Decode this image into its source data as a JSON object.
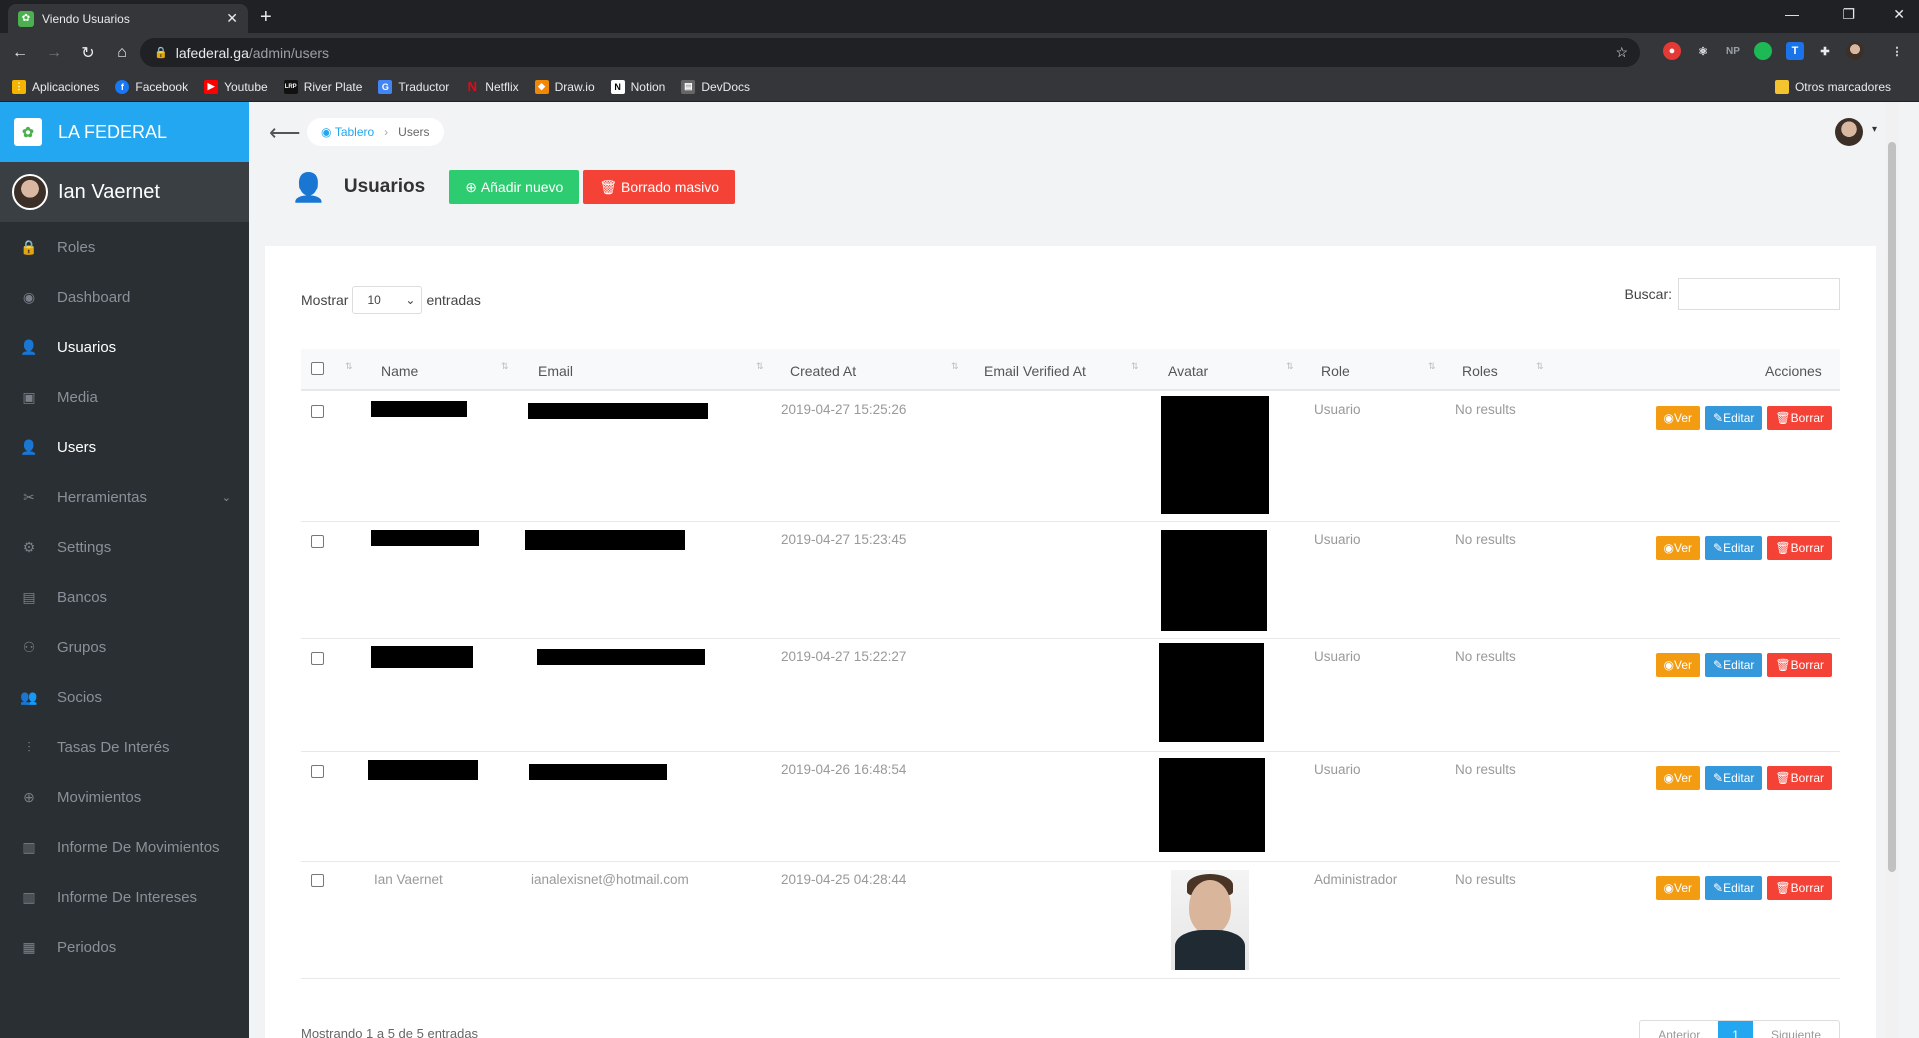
{
  "browser": {
    "tab_title": "Viendo Usuarios",
    "url_host": "lafederal.ga",
    "url_path": "/admin/users",
    "bookmarks": [
      {
        "label": "Aplicaciones",
        "color": "#f44336"
      },
      {
        "label": "Facebook",
        "color": "#1877f2"
      },
      {
        "label": "Youtube",
        "color": "#ff0000"
      },
      {
        "label": "River Plate",
        "color": "#111111"
      },
      {
        "label": "Traductor",
        "color": "#4285f4"
      },
      {
        "label": "Netflix",
        "color": "#e50914"
      },
      {
        "label": "Draw.io",
        "color": "#f08705"
      },
      {
        "label": "Notion",
        "color": "#ffffff"
      },
      {
        "label": "DevDocs",
        "color": "#555555"
      }
    ],
    "other_bookmarks": "Otros marcadores"
  },
  "sidebar": {
    "brand": "LA FEDERAL",
    "user_name": "Ian Vaernet",
    "items": [
      {
        "label": "Roles",
        "icon": "lock-icon",
        "glyph": "🔒"
      },
      {
        "label": "Dashboard",
        "icon": "dashboard-icon",
        "glyph": "◉"
      },
      {
        "label": "Usuarios",
        "icon": "person-icon",
        "glyph": "👤",
        "active": true
      },
      {
        "label": "Media",
        "icon": "image-icon",
        "glyph": "▣"
      },
      {
        "label": "Users",
        "icon": "person-icon",
        "glyph": "👤",
        "active": true
      },
      {
        "label": "Herramientas",
        "icon": "tools-icon",
        "glyph": "✂",
        "caret": true
      },
      {
        "label": "Settings",
        "icon": "gear-icon",
        "glyph": "⚙"
      },
      {
        "label": "Bancos",
        "icon": "bank-icon",
        "glyph": "▤"
      },
      {
        "label": "Grupos",
        "icon": "group-icon",
        "glyph": "⚇"
      },
      {
        "label": "Socios",
        "icon": "people-icon",
        "glyph": "👥"
      },
      {
        "label": "Tasas De Interés",
        "icon": "sliders-icon",
        "glyph": "⫶"
      },
      {
        "label": "Movimientos",
        "icon": "plus-circle-icon",
        "glyph": "⊕"
      },
      {
        "label": "Informe De Movimientos",
        "icon": "bar-chart-icon",
        "glyph": "▥"
      },
      {
        "label": "Informe De Intereses",
        "icon": "bar-chart-icon",
        "glyph": "▥"
      },
      {
        "label": "Periodos",
        "icon": "calendar-icon",
        "glyph": "▦"
      }
    ]
  },
  "header": {
    "breadcrumb_home": "Tablero",
    "breadcrumb_current": "Users",
    "page_title": "Usuarios",
    "add_button": "Añadir nuevo",
    "bulk_delete_button": "Borrado masivo"
  },
  "table": {
    "length_prefix": "Mostrar",
    "length_value": "10",
    "length_suffix": "entradas",
    "search_label": "Buscar:",
    "columns": [
      "Name",
      "Email",
      "Created At",
      "Email Verified At",
      "Avatar",
      "Role",
      "Roles",
      "Acciones"
    ],
    "rows": [
      {
        "name": "",
        "email": "",
        "created_at": "2019-04-27 15:25:26",
        "email_verified_at": "",
        "role": "Usuario",
        "roles": "No results"
      },
      {
        "name": "",
        "email": "",
        "created_at": "2019-04-27 15:23:45",
        "email_verified_at": "",
        "role": "Usuario",
        "roles": "No results"
      },
      {
        "name": "",
        "email": "",
        "created_at": "2019-04-27 15:22:27",
        "email_verified_at": "",
        "role": "Usuario",
        "roles": "No results"
      },
      {
        "name": "",
        "email": "",
        "created_at": "2019-04-26 16:48:54",
        "email_verified_at": "",
        "role": "Usuario",
        "roles": "No results"
      },
      {
        "name": "Ian Vaernet",
        "email": "ianalexisnet@hotmail.com",
        "created_at": "2019-04-25 04:28:44",
        "email_verified_at": "",
        "role": "Administrador",
        "roles": "No results"
      }
    ],
    "action_view": "Ver",
    "action_edit": "Editar",
    "action_delete": "Borrar",
    "info": "Mostrando 1 a 5 de 5 entradas",
    "prev": "Anterior",
    "page": "1",
    "next": "Siguiente"
  }
}
